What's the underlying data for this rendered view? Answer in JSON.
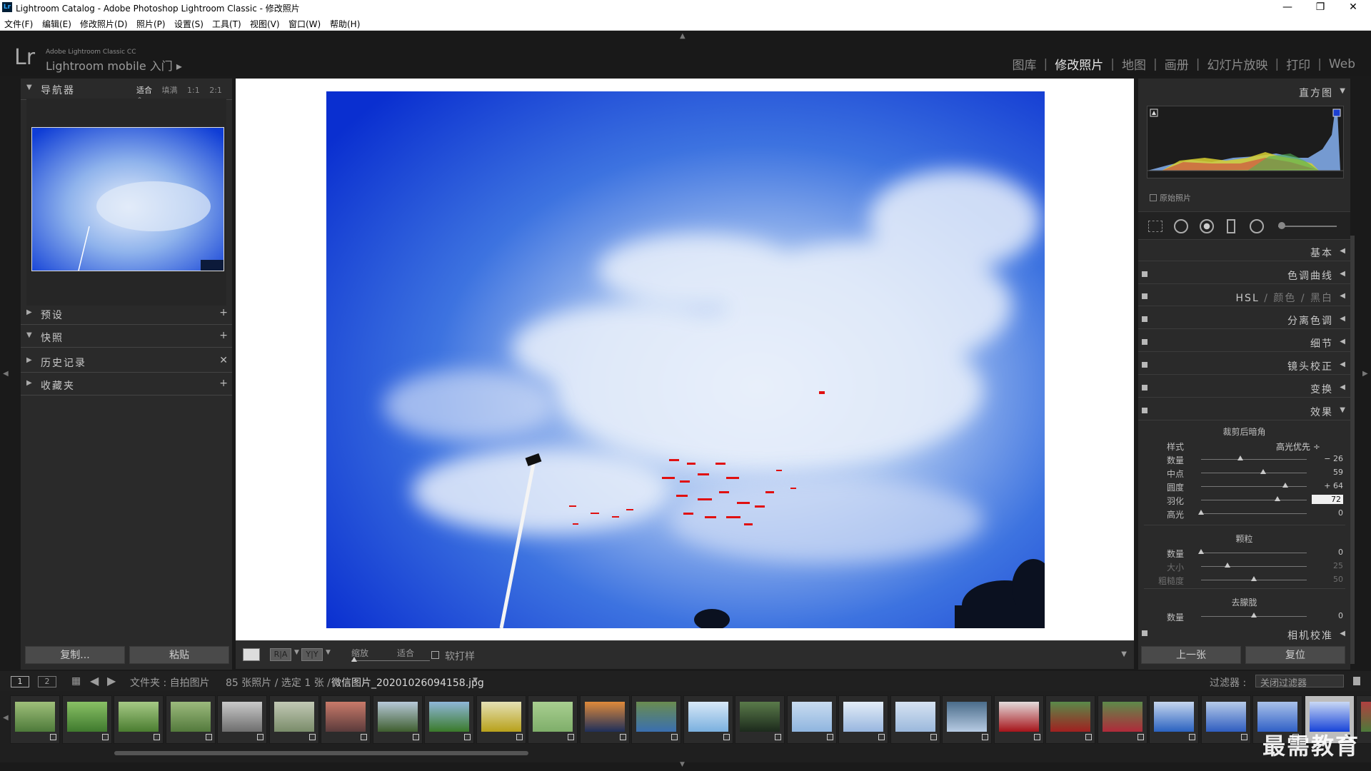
{
  "window": {
    "title": "Lightroom Catalog - Adobe Photoshop Lightroom Classic - 修改照片",
    "app_icon": "Lr",
    "minimize": "—",
    "restore": "❐",
    "close": "✕"
  },
  "menu": [
    "文件(F)",
    "编辑(E)",
    "修改照片(D)",
    "照片(P)",
    "设置(S)",
    "工具(T)",
    "视图(V)",
    "窗口(W)",
    "帮助(H)"
  ],
  "identity": {
    "logo": "Lr",
    "small": "Adobe Lightroom Classic CC",
    "big": "Lightroom mobile 入门 ▸"
  },
  "modules": [
    {
      "label": "图库",
      "active": false
    },
    {
      "label": "修改照片",
      "active": true
    },
    {
      "label": "地图",
      "active": false
    },
    {
      "label": "画册",
      "active": false
    },
    {
      "label": "幻灯片放映",
      "active": false
    },
    {
      "label": "打印",
      "active": false
    },
    {
      "label": "Web",
      "active": false
    }
  ],
  "left_panel": {
    "navigator": {
      "label": "导航器",
      "options": [
        "适合",
        "填满",
        "1:1",
        "2:1 ⇕"
      ],
      "active_option": "适合"
    },
    "sections": [
      {
        "label": "预设",
        "action": "+",
        "expanded": false
      },
      {
        "label": "快照",
        "action": "+",
        "expanded": true
      },
      {
        "label": "历史记录",
        "action": "✕",
        "expanded": false
      },
      {
        "label": "收藏夹",
        "action": "+",
        "expanded": false
      }
    ],
    "copy_label": "复制...",
    "paste_label": "粘贴"
  },
  "toolbar": {
    "view_before_after": "R|A",
    "view_before_after2": "Y|Y",
    "zoom_label": "缩放",
    "zoom_value": "适合",
    "softproof_label": "软打样"
  },
  "right_panel": {
    "histogram_label": "直方图",
    "original_photo_label": "原始照片",
    "sections": [
      {
        "label": "基本"
      },
      {
        "label": "色调曲线"
      },
      {
        "label": "HSL",
        "extra": [
          "颜色",
          "黑白"
        ]
      },
      {
        "label": "分离色调"
      },
      {
        "label": "细节"
      },
      {
        "label": "镜头校正"
      },
      {
        "label": "变换"
      },
      {
        "label": "效果",
        "expanded": true
      }
    ],
    "effects": {
      "vignette_title": "裁剪后暗角",
      "style_label": "样式",
      "style_value": "高光优先 ÷",
      "sliders": [
        {
          "label": "数量",
          "value": "− 26",
          "pos": 0.37
        },
        {
          "label": "中点",
          "value": "59",
          "pos": 0.59
        },
        {
          "label": "圆度",
          "value": "+ 64",
          "pos": 0.8
        },
        {
          "label": "羽化",
          "value": "72",
          "pos": 0.72
        },
        {
          "label": "高光",
          "value": "0",
          "pos": 0.0
        }
      ],
      "grain_title": "颗粒",
      "grain_sliders": [
        {
          "label": "数量",
          "value": "0",
          "pos": 0.0,
          "dim": false
        },
        {
          "label": "大小",
          "value": "25",
          "pos": 0.25,
          "dim": true
        },
        {
          "label": "粗糙度",
          "value": "50",
          "pos": 0.5,
          "dim": true
        }
      ],
      "dehaze_title": "去朦胧",
      "dehaze_sliders": [
        {
          "label": "数量",
          "value": "0",
          "pos": 0.5
        }
      ]
    },
    "camera_calibration": "相机校准",
    "prev_label": "上一张",
    "reset_label": "复位"
  },
  "filmstrip_bar": {
    "page1": "1",
    "page2": "2",
    "path_text": "文件夹 : 自拍图片",
    "count_text": "85 张照片 / 选定 1 张 /",
    "filename": "微信图片_20201026094158.jpg",
    "filter_label": "过滤器 :",
    "filter_value": "关闭过滤器"
  },
  "thumbnails": [
    {
      "c1": "#4d7a3a",
      "c2": "#9fbf7a"
    },
    {
      "c1": "#3f7a2e",
      "c2": "#89c065"
    },
    {
      "c1": "#4a7d30",
      "c2": "#a6c985"
    },
    {
      "c1": "#537a3c",
      "c2": "#9cba7d"
    },
    {
      "c1": "#6e6e6e",
      "c2": "#c9c9c9"
    },
    {
      "c1": "#7a8c6a",
      "c2": "#c2c9b5"
    },
    {
      "c1": "#5b3b3b",
      "c2": "#c97a6a"
    },
    {
      "c1": "#3f5e2f",
      "c2": "#b7c9d9"
    },
    {
      "c1": "#3a7a2a",
      "c2": "#8fb7d9"
    },
    {
      "c1": "#b8a11a",
      "c2": "#e5e1b5"
    },
    {
      "c1": "#7fae6a",
      "c2": "#a9cf90"
    },
    {
      "c1": "#1f2f5a",
      "c2": "#e08a3a"
    },
    {
      "c1": "#3a6fb0",
      "c2": "#6a8c50"
    },
    {
      "c1": "#7ab0df",
      "c2": "#d7e8f7"
    },
    {
      "c1": "#1c2a1c",
      "c2": "#5a7a4a"
    },
    {
      "c1": "#8fb5df",
      "c2": "#c9dcf0"
    },
    {
      "c1": "#98b6df",
      "c2": "#e3edf7"
    },
    {
      "c1": "#9bb8dc",
      "c2": "#d6e3f2"
    },
    {
      "c1": "#b7cbe3",
      "c2": "#4a6c8a"
    },
    {
      "c1": "#a6141a",
      "c2": "#e4dcdc"
    },
    {
      "c1": "#a02020",
      "c2": "#5a8a4a"
    },
    {
      "c1": "#b02a3a",
      "c2": "#5d8a4a"
    },
    {
      "c1": "#2a62c0",
      "c2": "#c6d6ef"
    },
    {
      "c1": "#2f5dc0",
      "c2": "#b6cbea"
    },
    {
      "c1": "#3060c6",
      "c2": "#a9c1ea"
    },
    {
      "c1": "#1743d8",
      "c2": "#c9d8f5"
    },
    {
      "c1": "#4d7a3a",
      "c2": "#b04040"
    }
  ],
  "selected_thumb": 25,
  "watermark": "最需教育"
}
